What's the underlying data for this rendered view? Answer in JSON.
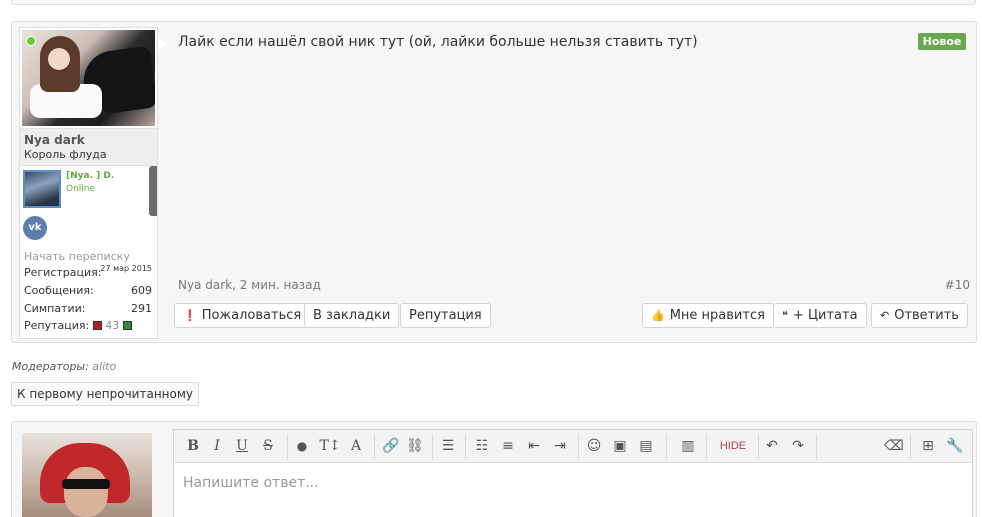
{
  "post": {
    "username": "Nya dark",
    "user_title": "Король флуда",
    "clan": {
      "name": "[Nya. ] D.",
      "status": "Online"
    },
    "start_conversation": "Начать переписку",
    "stats": [
      {
        "label": "Регистрация:",
        "value": "27 мар 2015"
      },
      {
        "label": "Сообщения:",
        "value": "609"
      },
      {
        "label": "Симпатии:",
        "value": "291"
      }
    ],
    "reputation": {
      "label": "Репутация:",
      "value": "43"
    },
    "message": "Лайк если нашёл свой ник тут (ой, лайки больше нельзя ставить тут)",
    "badge": "Новое",
    "meta": "Nya dark, 2 мин. назад",
    "number": "#10",
    "buttons_left": [
      "Пожаловаться",
      "В закладки",
      "Репутация"
    ],
    "buttons_right": [
      "Мне нравится",
      "+ Цитата",
      "Ответить"
    ]
  },
  "moderators": {
    "label": "Модераторы:",
    "name": "alito"
  },
  "unread_button": "К первому непрочитанному",
  "reply": {
    "placeholder": "Напишите ответ...",
    "toolbar": {
      "bold": "B",
      "italic": "I",
      "underline": "U",
      "strike": "S",
      "color": "●",
      "size": "T↕",
      "font": "A",
      "hide": "HIDE"
    }
  },
  "colors": {
    "accent_green": "#6aa84f",
    "online": "#66cc33",
    "vk": "#5b7fa6"
  }
}
